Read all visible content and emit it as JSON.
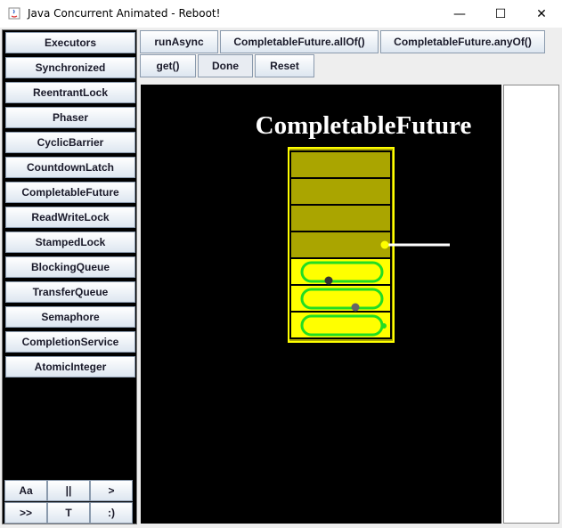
{
  "window": {
    "title": "Java Concurrent Animated - Reboot!",
    "minimize_glyph": "—",
    "maximize_glyph": "☐",
    "close_glyph": "✕"
  },
  "sidebar": {
    "items": [
      {
        "label": "Executors"
      },
      {
        "label": "Synchronized"
      },
      {
        "label": "ReentrantLock"
      },
      {
        "label": "Phaser"
      },
      {
        "label": "CyclicBarrier"
      },
      {
        "label": "CountdownLatch"
      },
      {
        "label": "CompletableFuture"
      },
      {
        "label": "ReadWriteLock"
      },
      {
        "label": "StampedLock"
      },
      {
        "label": "BlockingQueue"
      },
      {
        "label": "TransferQueue"
      },
      {
        "label": "Semaphore"
      },
      {
        "label": "CompletionService"
      },
      {
        "label": "AtomicInteger"
      }
    ],
    "controls": [
      "Aa",
      "||",
      ">",
      ">>",
      "T",
      ":)"
    ]
  },
  "toolbar": {
    "run_async": "runAsync",
    "all_of": "CompletableFuture.allOf()",
    "any_of": "CompletableFuture.anyOf()",
    "get": "get()",
    "done": "Done",
    "reset": "Reset"
  },
  "animation": {
    "title": "CompletableFuture",
    "colors": {
      "background": "#000000",
      "container_border": "#ffff00",
      "olive_slot": "#aaa500",
      "active_slot": "#ffff00",
      "thread_loop": "#22dd22",
      "line": "#ffffff"
    }
  }
}
